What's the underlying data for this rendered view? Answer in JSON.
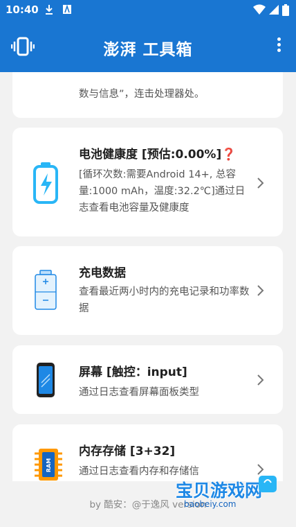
{
  "status_bar": {
    "time": "10:40"
  },
  "app_bar": {
    "title": "澎湃 工具箱"
  },
  "cards": [
    {
      "desc": "数与信息”，连击处理器处。"
    },
    {
      "title": "电池健康度 [预估:0.00%]❓",
      "desc": "[循环次数:需要Android 14+, 总容量:1000 mAh，温度:32.2℃]通过日志查看电池容量及健康度"
    },
    {
      "title": "充电数据",
      "desc": "查看最近两小时内的充电记录和功率数据"
    },
    {
      "title": "屏幕 [触控：input]",
      "desc": "通过日志查看屏幕面板类型"
    },
    {
      "title": "内存存储 [3+32]",
      "desc": "通过日志查看内存和存储信"
    }
  ],
  "footer": {
    "text": "by 酷安：@于逸风 version"
  },
  "watermark": {
    "text": "宝贝游戏网",
    "url": "baobeiy.com"
  },
  "colors": {
    "primary": "#1976d2",
    "background": "#f2f2f2",
    "card": "#ffffff"
  }
}
